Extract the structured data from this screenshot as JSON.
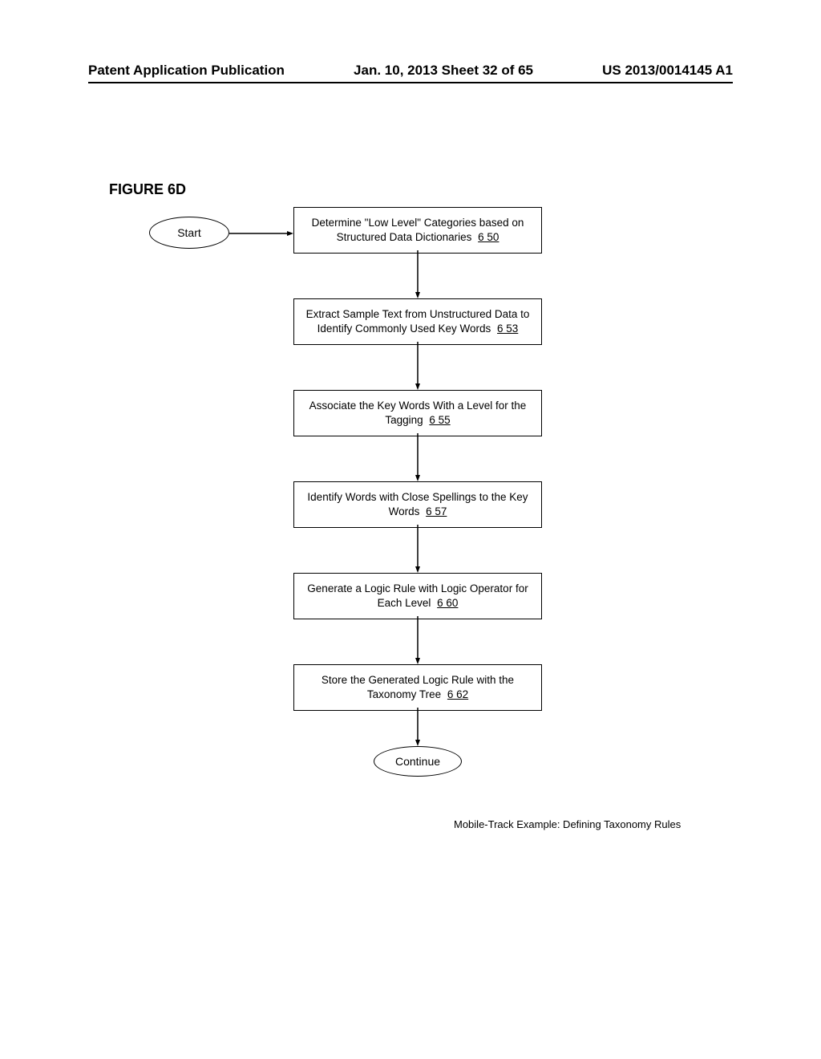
{
  "header": {
    "left": "Patent Application Publication",
    "center": "Jan. 10, 2013  Sheet 32 of 65",
    "right": "US 2013/0014145 A1"
  },
  "figure_label": "FIGURE 6D",
  "terminals": {
    "start": "Start",
    "continue": "Continue"
  },
  "steps": [
    {
      "text": "Determine \"Low Level\" Categories based on Structured Data Dictionaries",
      "ref": "6 50"
    },
    {
      "text": "Extract Sample Text from Unstructured Data to Identify Commonly Used Key Words",
      "ref": "6 53"
    },
    {
      "text": "Associate the Key Words With a Level for the Tagging",
      "ref": "6 55"
    },
    {
      "text": "Identify Words with Close Spellings to the Key Words",
      "ref": "6 57"
    },
    {
      "text": "Generate a Logic Rule with Logic Operator for Each Level",
      "ref": "6 60"
    },
    {
      "text": "Store the Generated Logic Rule with the Taxonomy Tree",
      "ref": "6 62"
    }
  ],
  "caption": "Mobile-Track Example: Defining Taxonomy Rules"
}
